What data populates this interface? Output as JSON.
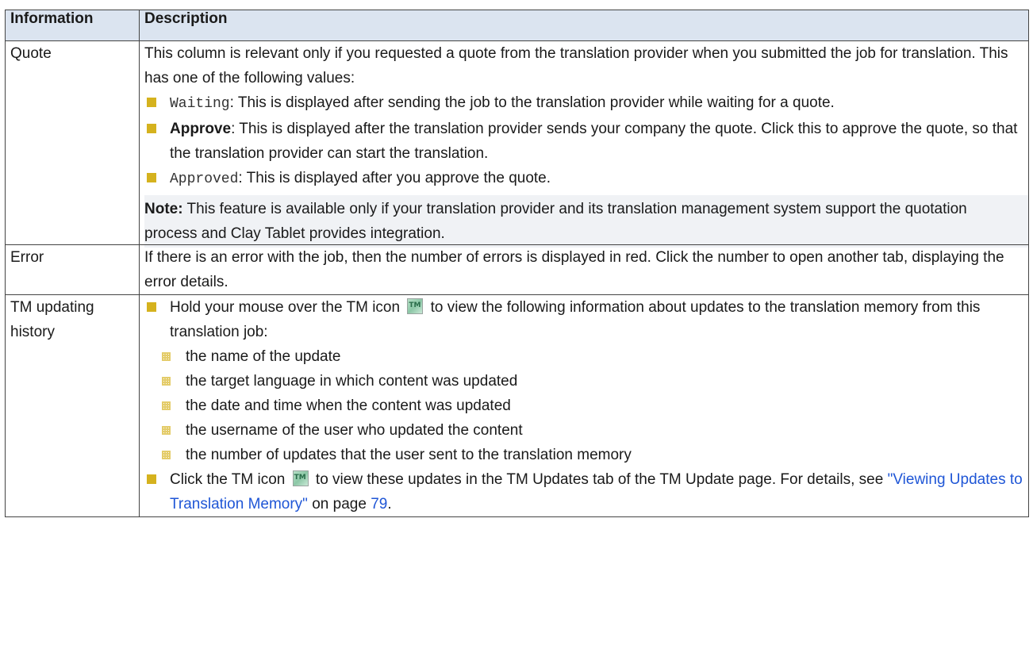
{
  "table": {
    "headers": [
      "Information",
      "Description"
    ],
    "quote": {
      "label": "Quote",
      "intro": "This column is relevant only if you requested a quote from the translation provider when you submitted the job for translation. This has one of the following values:",
      "waiting_code": "Waiting",
      "waiting_text": ": This is displayed after sending the job to the translation provider while waiting for a quote.",
      "approve_bold": "Approve",
      "approve_text": ": This is displayed after the translation provider sends your company the quote. Click this to approve the quote, so that the translation provider can start the translation.",
      "approved_code": "Approved",
      "approved_text": ": This is displayed after you approve the quote.",
      "note_bold": "Note:",
      "note_text": " This feature is available only if your translation provider and its translation management system support the quotation process and Clay Tablet provides integration."
    },
    "error": {
      "label": "Error",
      "text": "If there is an error with the job, then the number of errors is displayed in red. Click the number to open another tab, displaying the error details."
    },
    "tm": {
      "label": "TM updating history",
      "hold_before": "Hold your mouse over the TM icon",
      "hold_after": " to view the following information about updates to the translation memory from this translation job:",
      "items": [
        "the name of the update",
        "the target language in which content was updated",
        "the date and time when the content was updated",
        "the username of the user who updated the content",
        "the number of updates that the user sent to the translation memory"
      ],
      "click_before": "Click the TM icon",
      "click_after": " to view these updates in the TM Updates tab of the TM Update page. For details, see ",
      "link_text": "\"Viewing Updates to Translation Memory\"",
      "page_prefix": " on page ",
      "page_num": "79",
      "period": "."
    }
  },
  "icons": {
    "bullet": "square-bullet-icon",
    "sub_bullet": "grid-bullet-icon",
    "tm": "tm-icon"
  },
  "colors": {
    "header_bg": "#dbe4f0",
    "bullet": "#d5b21e",
    "link": "#1f56d6"
  }
}
